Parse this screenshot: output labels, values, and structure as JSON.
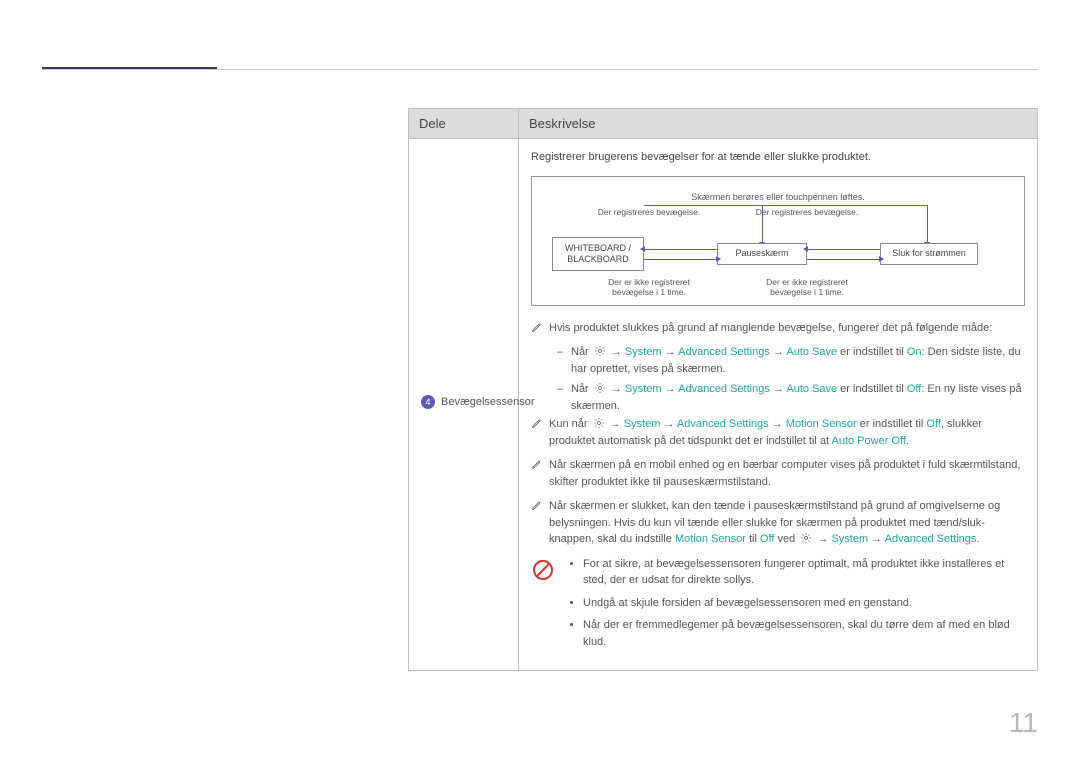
{
  "page_number": "11",
  "table": {
    "headers": {
      "dele": "Dele",
      "beskrivelse": "Beskrivelse"
    },
    "row": {
      "num": "4",
      "name": "Bevægelsessensor",
      "intro": "Registrerer brugerens bevægelser for at tænde eller slukke produktet.",
      "diagram": {
        "top_caption": "Skærmen berøres eller touchpennen løftes.",
        "box1a": "WHITEBOARD /",
        "box1b": "BLACKBOARD",
        "box2": "Pauseskærm",
        "box3": "Sluk for strømmen",
        "lbl_top_left": "Der registreres bevægelse.",
        "lbl_top_right": "Der registreres bevægelse.",
        "lbl_bot_left": "Der er ikke registreret bevægelse i 1 time.",
        "lbl_bot_right": "Der er ikke registreret bevægelse i 1 time."
      },
      "notes": {
        "n1": "Hvis produktet slukkes på grund af manglende bevægelse, fungerer det på følgende måde:",
        "n1a_pre": "Når ",
        "n1a_sys": "System",
        "n1a_adv": "Advanced Settings",
        "n1a_as": "Auto Save",
        "n1a_mid": " er indstillet til ",
        "n1a_on": "On",
        "n1a_post": ": Den sidste liste, du har oprettet, vises på skærmen.",
        "n1b_pre": "Når ",
        "n1b_mid": " er indstillet til ",
        "n1b_off": "Off",
        "n1b_post": ": En ny liste vises på skærmen.",
        "n2_pre": "Kun når ",
        "n2_sys": "System",
        "n2_adv": "Advanced Settings",
        "n2_ms": "Motion Sensor",
        "n2_mid": " er indstillet til ",
        "n2_off": "Off",
        "n2_post": ", slukker produktet automatisk på det tidspunkt det er indstillet til at ",
        "n2_ap": "Auto Power Off",
        "n2_end": ".",
        "n3": "Når skærmen på en mobil enhed og en bærbar computer vises på produktet i fuld skærmtilstand, skifter produktet ikke til pauseskærmstilstand.",
        "n4_a": "Når skærmen er slukket, kan den tænde i pauseskærmstilstand på grund af omgivelserne og belysningen. Hvis du kun vil tænde eller slukke for skærmen på produktet med tænd/sluk-knappen, skal du indstille ",
        "n4_ms": "Motion Sensor",
        "n4_b": " til ",
        "n4_off": "Off",
        "n4_c": " ved ",
        "n4_sys": "System",
        "n4_adv": "Advanced Settings",
        "n4_end": "."
      },
      "warnings": {
        "w1": "For at sikre, at bevægelsessensoren fungerer optimalt, må produktet ikke installeres et sted, der er udsat for direkte sollys.",
        "w2": "Undgå at skjule forsiden af bevægelsessensoren med en genstand.",
        "w3": "Når der er fremmedlegemer på bevægelsessensoren, skal du tørre dem af med en blød klud."
      }
    }
  }
}
